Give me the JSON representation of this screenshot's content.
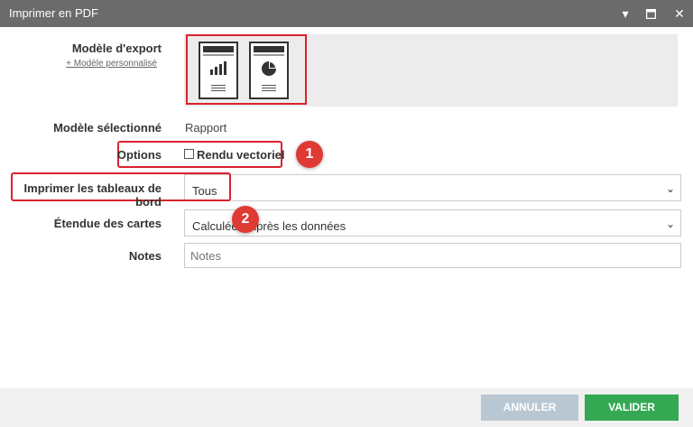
{
  "window": {
    "title": "Imprimer en PDF"
  },
  "form": {
    "export_model_label": "Modèle d'export",
    "custom_model_link": "+ Modèle personnalisé",
    "selected_model_label": "Modèle sélectionné",
    "selected_model_value": "Rapport",
    "options_label": "Options",
    "vector_render_label": "Rendu vectoriel",
    "vector_render_checked": false,
    "print_dashboards_label": "Imprimer les tableaux de bord",
    "print_dashboards_value": "Tous",
    "map_extent_label": "Étendue des cartes",
    "map_extent_value": "Calculée d'après les données",
    "notes_label": "Notes",
    "notes_placeholder": "Notes"
  },
  "annotations": {
    "badge1": "1",
    "badge2": "2"
  },
  "footer": {
    "cancel_label": "ANNULER",
    "validate_label": "VALIDER"
  },
  "colors": {
    "titlebar": "#6b6b6b",
    "highlight": "#d9232e",
    "badge": "#e03a35",
    "cancel": "#b9c7d3",
    "validate": "#34a853"
  }
}
